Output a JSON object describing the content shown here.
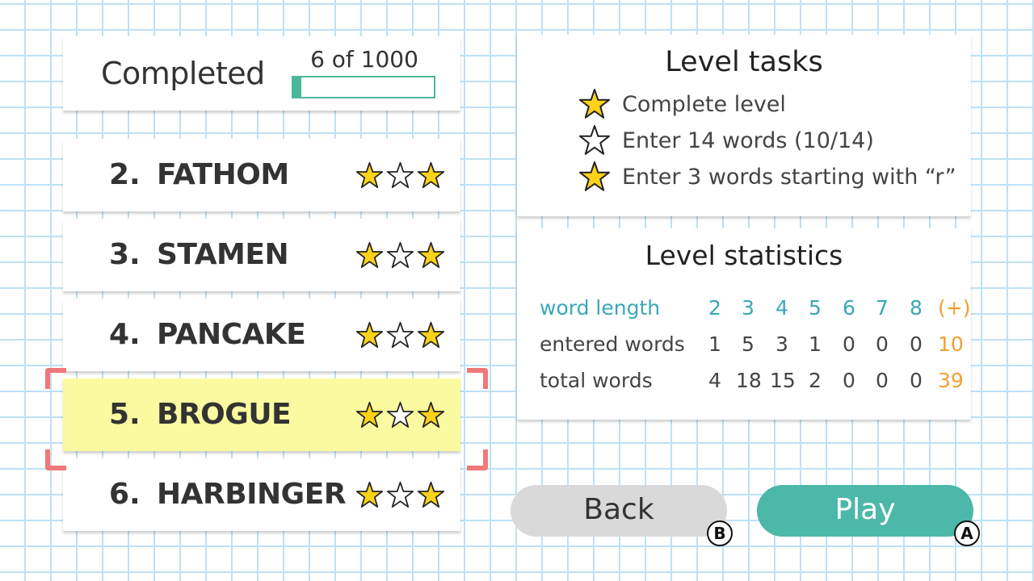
{
  "header": {
    "completed_label": "Completed",
    "progress_text": "6 of 1000",
    "progress_value": 0.006
  },
  "levels": [
    {
      "number": "2.",
      "word": "FATHOM",
      "stars": [
        true,
        false,
        true
      ],
      "selected": false
    },
    {
      "number": "3.",
      "word": "STAMEN",
      "stars": [
        true,
        false,
        true
      ],
      "selected": false
    },
    {
      "number": "4.",
      "word": "PANCAKE",
      "stars": [
        true,
        false,
        true
      ],
      "selected": false
    },
    {
      "number": "5.",
      "word": "BROGUE",
      "stars": [
        true,
        false,
        true
      ],
      "selected": true
    },
    {
      "number": "6.",
      "word": "HARBINGER",
      "stars": [
        true,
        false,
        true
      ],
      "selected": false
    }
  ],
  "tasks": {
    "title": "Level tasks",
    "items": [
      {
        "text": "Complete level",
        "done": true
      },
      {
        "text": "Enter 14 words (10/14)",
        "done": false
      },
      {
        "text": "Enter 3 words starting with “r”",
        "done": true
      }
    ]
  },
  "statistics": {
    "title": "Level statistics",
    "header_label": "word length",
    "columns": [
      "2",
      "3",
      "4",
      "5",
      "6",
      "7",
      "8",
      "(+)"
    ],
    "rows": [
      {
        "label": "entered words",
        "values": [
          "1",
          "5",
          "3",
          "1",
          "0",
          "0",
          "0",
          "10"
        ]
      },
      {
        "label": "total words",
        "values": [
          "4",
          "18",
          "15",
          "2",
          "0",
          "0",
          "0",
          "39"
        ]
      }
    ]
  },
  "buttons": {
    "back_label": "Back",
    "back_hint": "B",
    "play_label": "Play",
    "play_hint": "A"
  },
  "colors": {
    "accent_teal": "#4cb8a8",
    "stat_teal": "#3aa8b8",
    "total_orange": "#f0a030",
    "selection_yellow": "#fafba0",
    "selection_bracket": "#f07878",
    "star_gold": "#ffd21a"
  }
}
